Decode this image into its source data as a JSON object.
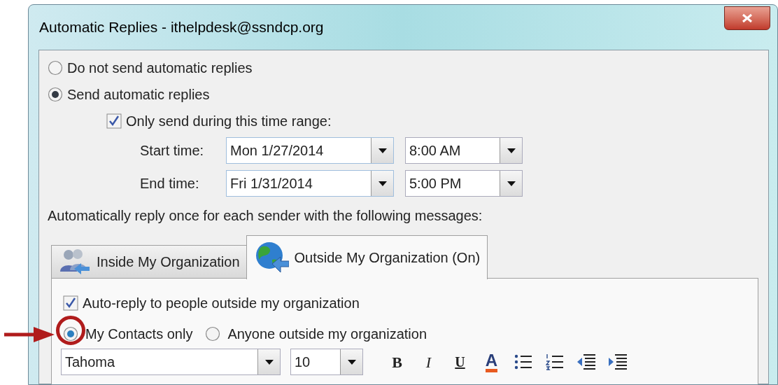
{
  "window": {
    "title": "Automatic Replies - ithelpdesk@ssndcp.org"
  },
  "reply_mode": [
    {
      "label": "Do not send automatic replies",
      "selected": false
    },
    {
      "label": "Send automatic replies",
      "selected": true
    }
  ],
  "time_range": {
    "label": "Only send during this time range:",
    "checked": true
  },
  "times": [
    {
      "label": "Start time:",
      "date": "Mon 1/27/2014",
      "time": "8:00 AM"
    },
    {
      "label": "End time:",
      "date": "Fri 1/31/2014",
      "time": "5:00 PM"
    }
  ],
  "instruction": "Automatically reply once for each sender with the following messages:",
  "tabs": [
    {
      "label": "Inside My Organization",
      "kind": "people",
      "selected": false
    },
    {
      "label": "Outside My Organization (On)",
      "kind": "globe",
      "selected": true
    }
  ],
  "auto_reply": {
    "label": "Auto-reply to people outside my organization",
    "checked": true
  },
  "audience": [
    {
      "label": "My Contacts only",
      "selected": true,
      "highlighted": true
    },
    {
      "label": "Anyone outside my organization",
      "selected": false,
      "highlighted": false
    }
  ],
  "toolbar": {
    "font": "Tahoma",
    "size": "10",
    "buttons": [
      {
        "kind": "bold",
        "label": "B"
      },
      {
        "kind": "italic",
        "label": "I"
      },
      {
        "kind": "underline",
        "label": "U"
      },
      {
        "kind": "font-color",
        "label": "A"
      },
      {
        "kind": "bullets"
      },
      {
        "kind": "numbering"
      },
      {
        "kind": "decrease-indent"
      },
      {
        "kind": "increase-indent"
      }
    ]
  }
}
